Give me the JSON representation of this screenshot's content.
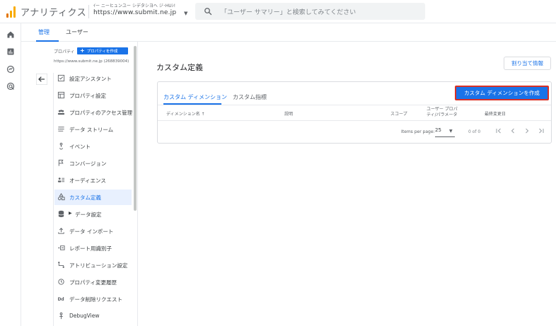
{
  "header": {
    "app_title": "アナリティクス",
    "account_line1": "ｲー ニーヒュンユー シデタシヨへ ジ･HUｼ!",
    "account_line2": "https://www.submit.ne.jp",
    "search_placeholder": "「ユーザー サマリー」と検索してみてください"
  },
  "subtabs": [
    {
      "label": "管理"
    },
    {
      "label": "ユーザー"
    }
  ],
  "property": {
    "label": "プロパティ",
    "create_button": "プロパティを作成",
    "url": "https://www.submit.ne.jp (268839004)"
  },
  "nav": {
    "items": [
      {
        "label": "設定アシスタント",
        "icon": "checklist-icon"
      },
      {
        "label": "プロパティ設定",
        "icon": "property-settings-icon"
      },
      {
        "label": "プロパティのアクセス管理",
        "icon": "people-icon"
      },
      {
        "label": "データ ストリーム",
        "icon": "data-stream-icon"
      },
      {
        "label": "イベント",
        "icon": "event-icon"
      },
      {
        "label": "コンバージョン",
        "icon": "flag-icon"
      },
      {
        "label": "オーディエンス",
        "icon": "audience-icon"
      },
      {
        "label": "カスタム定義",
        "icon": "shapes-icon",
        "active": true
      },
      {
        "label": "データ設定",
        "icon": "database-icon"
      },
      {
        "label": "データ インポート",
        "icon": "upload-icon"
      },
      {
        "label": "レポート用識別子",
        "icon": "identity-icon"
      },
      {
        "label": "アトリビューション設定",
        "icon": "attribution-icon"
      },
      {
        "label": "プロパティ変更履歴",
        "icon": "history-icon"
      },
      {
        "label": "データ削除リクエスト",
        "icon": "dd-icon"
      },
      {
        "label": "DebugView",
        "icon": "debug-icon"
      }
    ]
  },
  "main": {
    "title": "カスタム定義",
    "assign_button": "割り当て情報",
    "tabs": [
      {
        "label": "カスタム ディメンション",
        "active": true
      },
      {
        "label": "カスタム指標"
      }
    ],
    "create_button": "カスタム ディメンションを作成",
    "table": {
      "headers": [
        "ディメンション名 ↑",
        "説明",
        "スコープ",
        "ユーザー プロパティ/パラメータ",
        "最終変更日"
      ],
      "header_user_prop_line1": "ユーザー プロパ",
      "header_user_prop_line2": "ティ/パラメータ"
    },
    "pager": {
      "items_per_page_label": "Items per page:",
      "items_per_page": "25",
      "count": "0 of 0"
    }
  },
  "colors": {
    "accent": "#1a73e8",
    "highlight_border": "#d93025"
  }
}
